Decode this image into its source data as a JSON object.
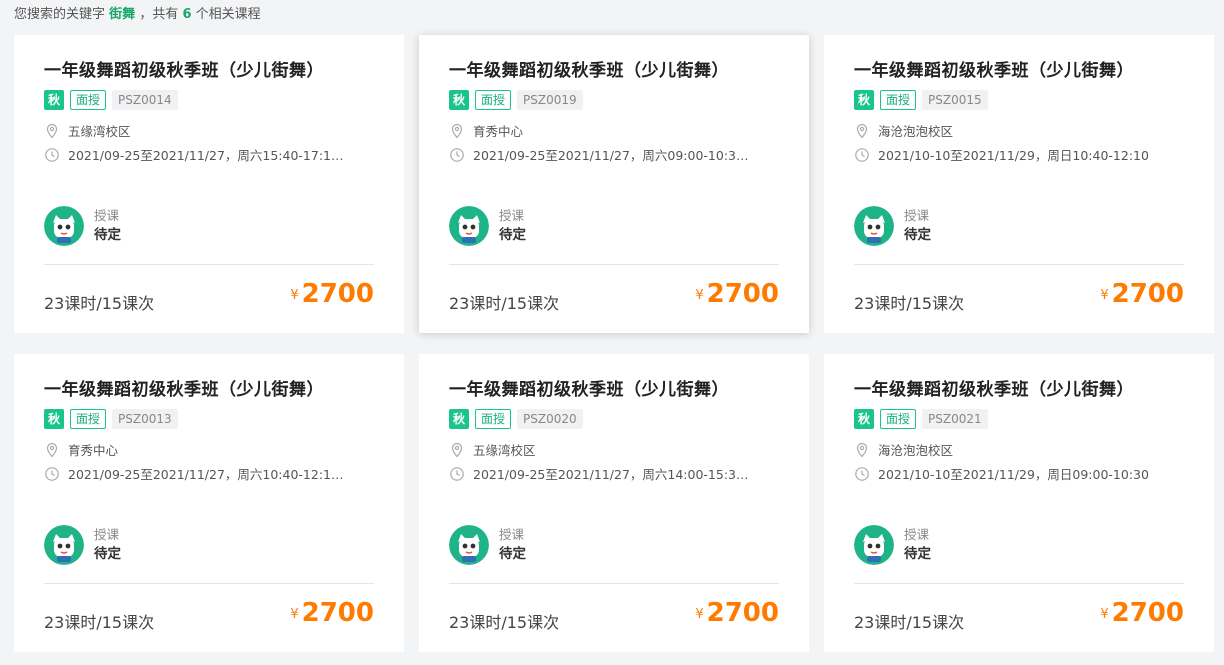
{
  "search": {
    "prefix": "您搜索的关键字",
    "keyword": "街舞",
    "middle": "，共有",
    "count": "6",
    "suffix": "个相关课程"
  },
  "colors": {
    "accent": "#19c58a",
    "price": "#ff7a00"
  },
  "cards": [
    {
      "title": "一年级舞蹈初级秋季班（少儿街舞）",
      "season": "秋",
      "mode": "面授",
      "code": "PSZ0014",
      "location": "五缘湾校区",
      "time": "2021/09-25至2021/11/27，周六15:40-17:10...",
      "teacher_label": "授课",
      "teacher": "待定",
      "hours": "23课时/15课次",
      "currency": "¥",
      "price": "2700"
    },
    {
      "title": "一年级舞蹈初级秋季班（少儿街舞）",
      "season": "秋",
      "mode": "面授",
      "code": "PSZ0019",
      "location": "育秀中心",
      "time": "2021/09-25至2021/11/27，周六09:00-10:30...",
      "teacher_label": "授课",
      "teacher": "待定",
      "hours": "23课时/15课次",
      "currency": "¥",
      "price": "2700"
    },
    {
      "title": "一年级舞蹈初级秋季班（少儿街舞）",
      "season": "秋",
      "mode": "面授",
      "code": "PSZ0015",
      "location": "海沧泡泡校区",
      "time": "2021/10-10至2021/11/29，周日10:40-12:10",
      "teacher_label": "授课",
      "teacher": "待定",
      "hours": "23课时/15课次",
      "currency": "¥",
      "price": "2700"
    },
    {
      "title": "一年级舞蹈初级秋季班（少儿街舞）",
      "season": "秋",
      "mode": "面授",
      "code": "PSZ0013",
      "location": "育秀中心",
      "time": "2021/09-25至2021/11/27，周六10:40-12:10...",
      "teacher_label": "授课",
      "teacher": "待定",
      "hours": "23课时/15课次",
      "currency": "¥",
      "price": "2700"
    },
    {
      "title": "一年级舞蹈初级秋季班（少儿街舞）",
      "season": "秋",
      "mode": "面授",
      "code": "PSZ0020",
      "location": "五缘湾校区",
      "time": "2021/09-25至2021/11/27，周六14:00-15:30...",
      "teacher_label": "授课",
      "teacher": "待定",
      "hours": "23课时/15课次",
      "currency": "¥",
      "price": "2700"
    },
    {
      "title": "一年级舞蹈初级秋季班（少儿街舞）",
      "season": "秋",
      "mode": "面授",
      "code": "PSZ0021",
      "location": "海沧泡泡校区",
      "time": "2021/10-10至2021/11/29，周日09:00-10:30",
      "teacher_label": "授课",
      "teacher": "待定",
      "hours": "23课时/15课次",
      "currency": "¥",
      "price": "2700"
    }
  ]
}
